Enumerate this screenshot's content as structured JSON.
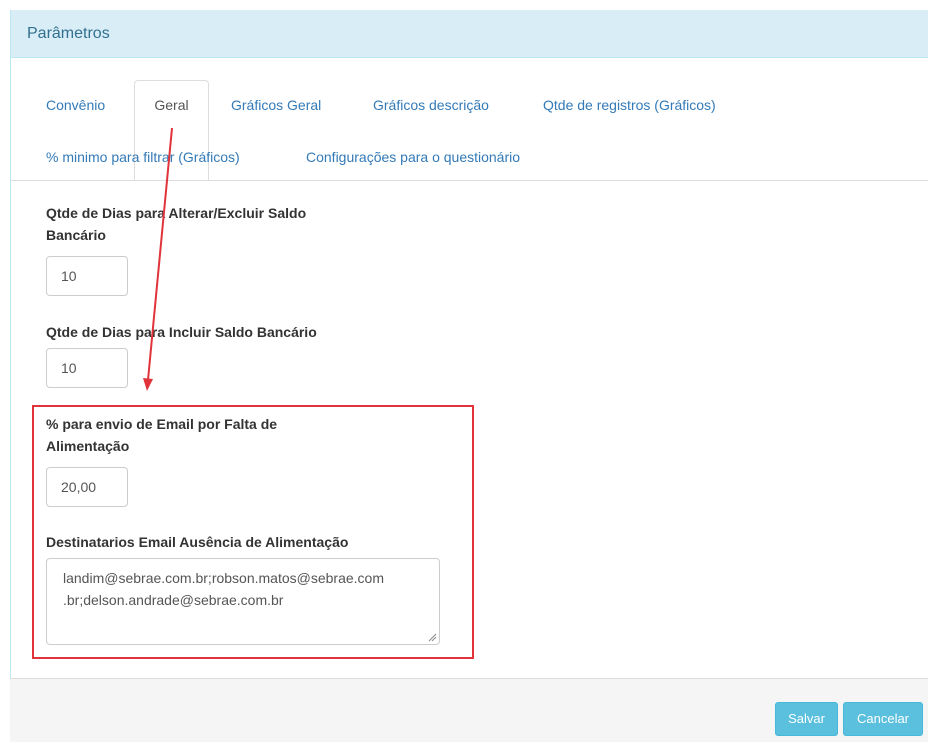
{
  "panel": {
    "title": "Parâmetros"
  },
  "tabs": [
    {
      "label": "Convênio",
      "active": false
    },
    {
      "label": "Geral",
      "active": true
    },
    {
      "label": "Gráficos Geral",
      "active": false
    },
    {
      "label": "Gráficos descrição",
      "active": false
    },
    {
      "label": "Qtde de registros (Gráficos)",
      "active": false
    },
    {
      "label": "% minimo para filtrar (Gráficos)",
      "active": false
    },
    {
      "label": "Configurações para o questionário",
      "active": false
    }
  ],
  "fields": {
    "dias_alterar": {
      "label_line1": "Qtde de Dias para Alterar/Excluir Saldo",
      "label_line2": "Bancário",
      "value": "10"
    },
    "dias_incluir": {
      "label": "Qtde de Dias para Incluir Saldo Bancário",
      "value": "10"
    },
    "percent_email": {
      "label_line1": "% para envio de Email por Falta de",
      "label_line2": "Alimentação",
      "value": "20,00"
    },
    "destinatarios": {
      "label": "Destinatarios Email Ausência de Alimentação",
      "value_line1": "landim@sebrae.com.br;robson.matos@sebrae.com",
      "value_line2": ".br;delson.andrade@sebrae.com.br"
    }
  },
  "footer": {
    "save_label": "Salvar",
    "cancel_label": "Cancelar"
  },
  "colors": {
    "heading_bg": "#d9edf7",
    "link": "#337ab7",
    "annotation_red": "#e0343a",
    "button_info": "#5bc0de"
  }
}
